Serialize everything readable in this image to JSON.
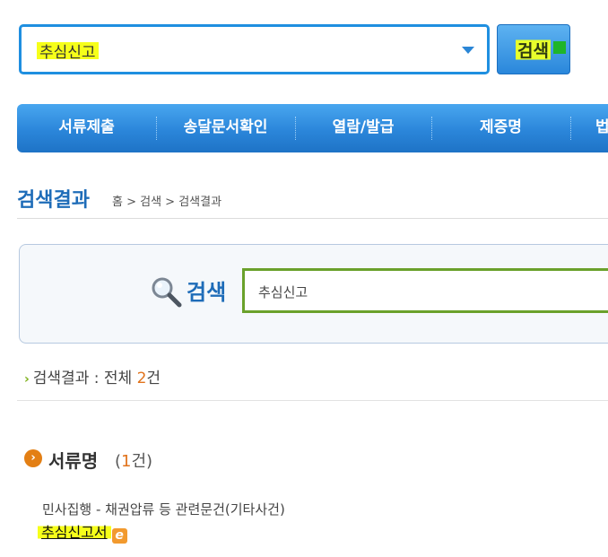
{
  "top_search": {
    "value": "추심신고",
    "button_label": "검색"
  },
  "nav": {
    "items": [
      "서류제출",
      "송달문서확인",
      "열람/발급",
      "제증명",
      "법"
    ]
  },
  "page": {
    "title": "검색결과",
    "breadcrumb": "홈 > 검색 > 검색결과"
  },
  "search_panel": {
    "label": "검색",
    "input_value": "추심신고"
  },
  "results": {
    "summary_prefix": "검색결과 : 전체 ",
    "total_count": "2",
    "summary_suffix": "건"
  },
  "section": {
    "title": "서류명",
    "count_open": "(",
    "count": "1",
    "count_close": "건)",
    "category_path": "민사집행 - 채권압류 등 관련문건(기타사건)",
    "doc_link": "추심신고서"
  },
  "colors": {
    "accent_blue": "#2a86d6",
    "highlight_yellow": "#f6ff1a",
    "count_orange": "#e1731c",
    "input_green": "#6aa12b"
  },
  "icons": [
    "dropdown-arrow-icon",
    "magnifier-icon",
    "chevron-right-icon",
    "section-bullet-icon",
    "e-form-icon"
  ]
}
